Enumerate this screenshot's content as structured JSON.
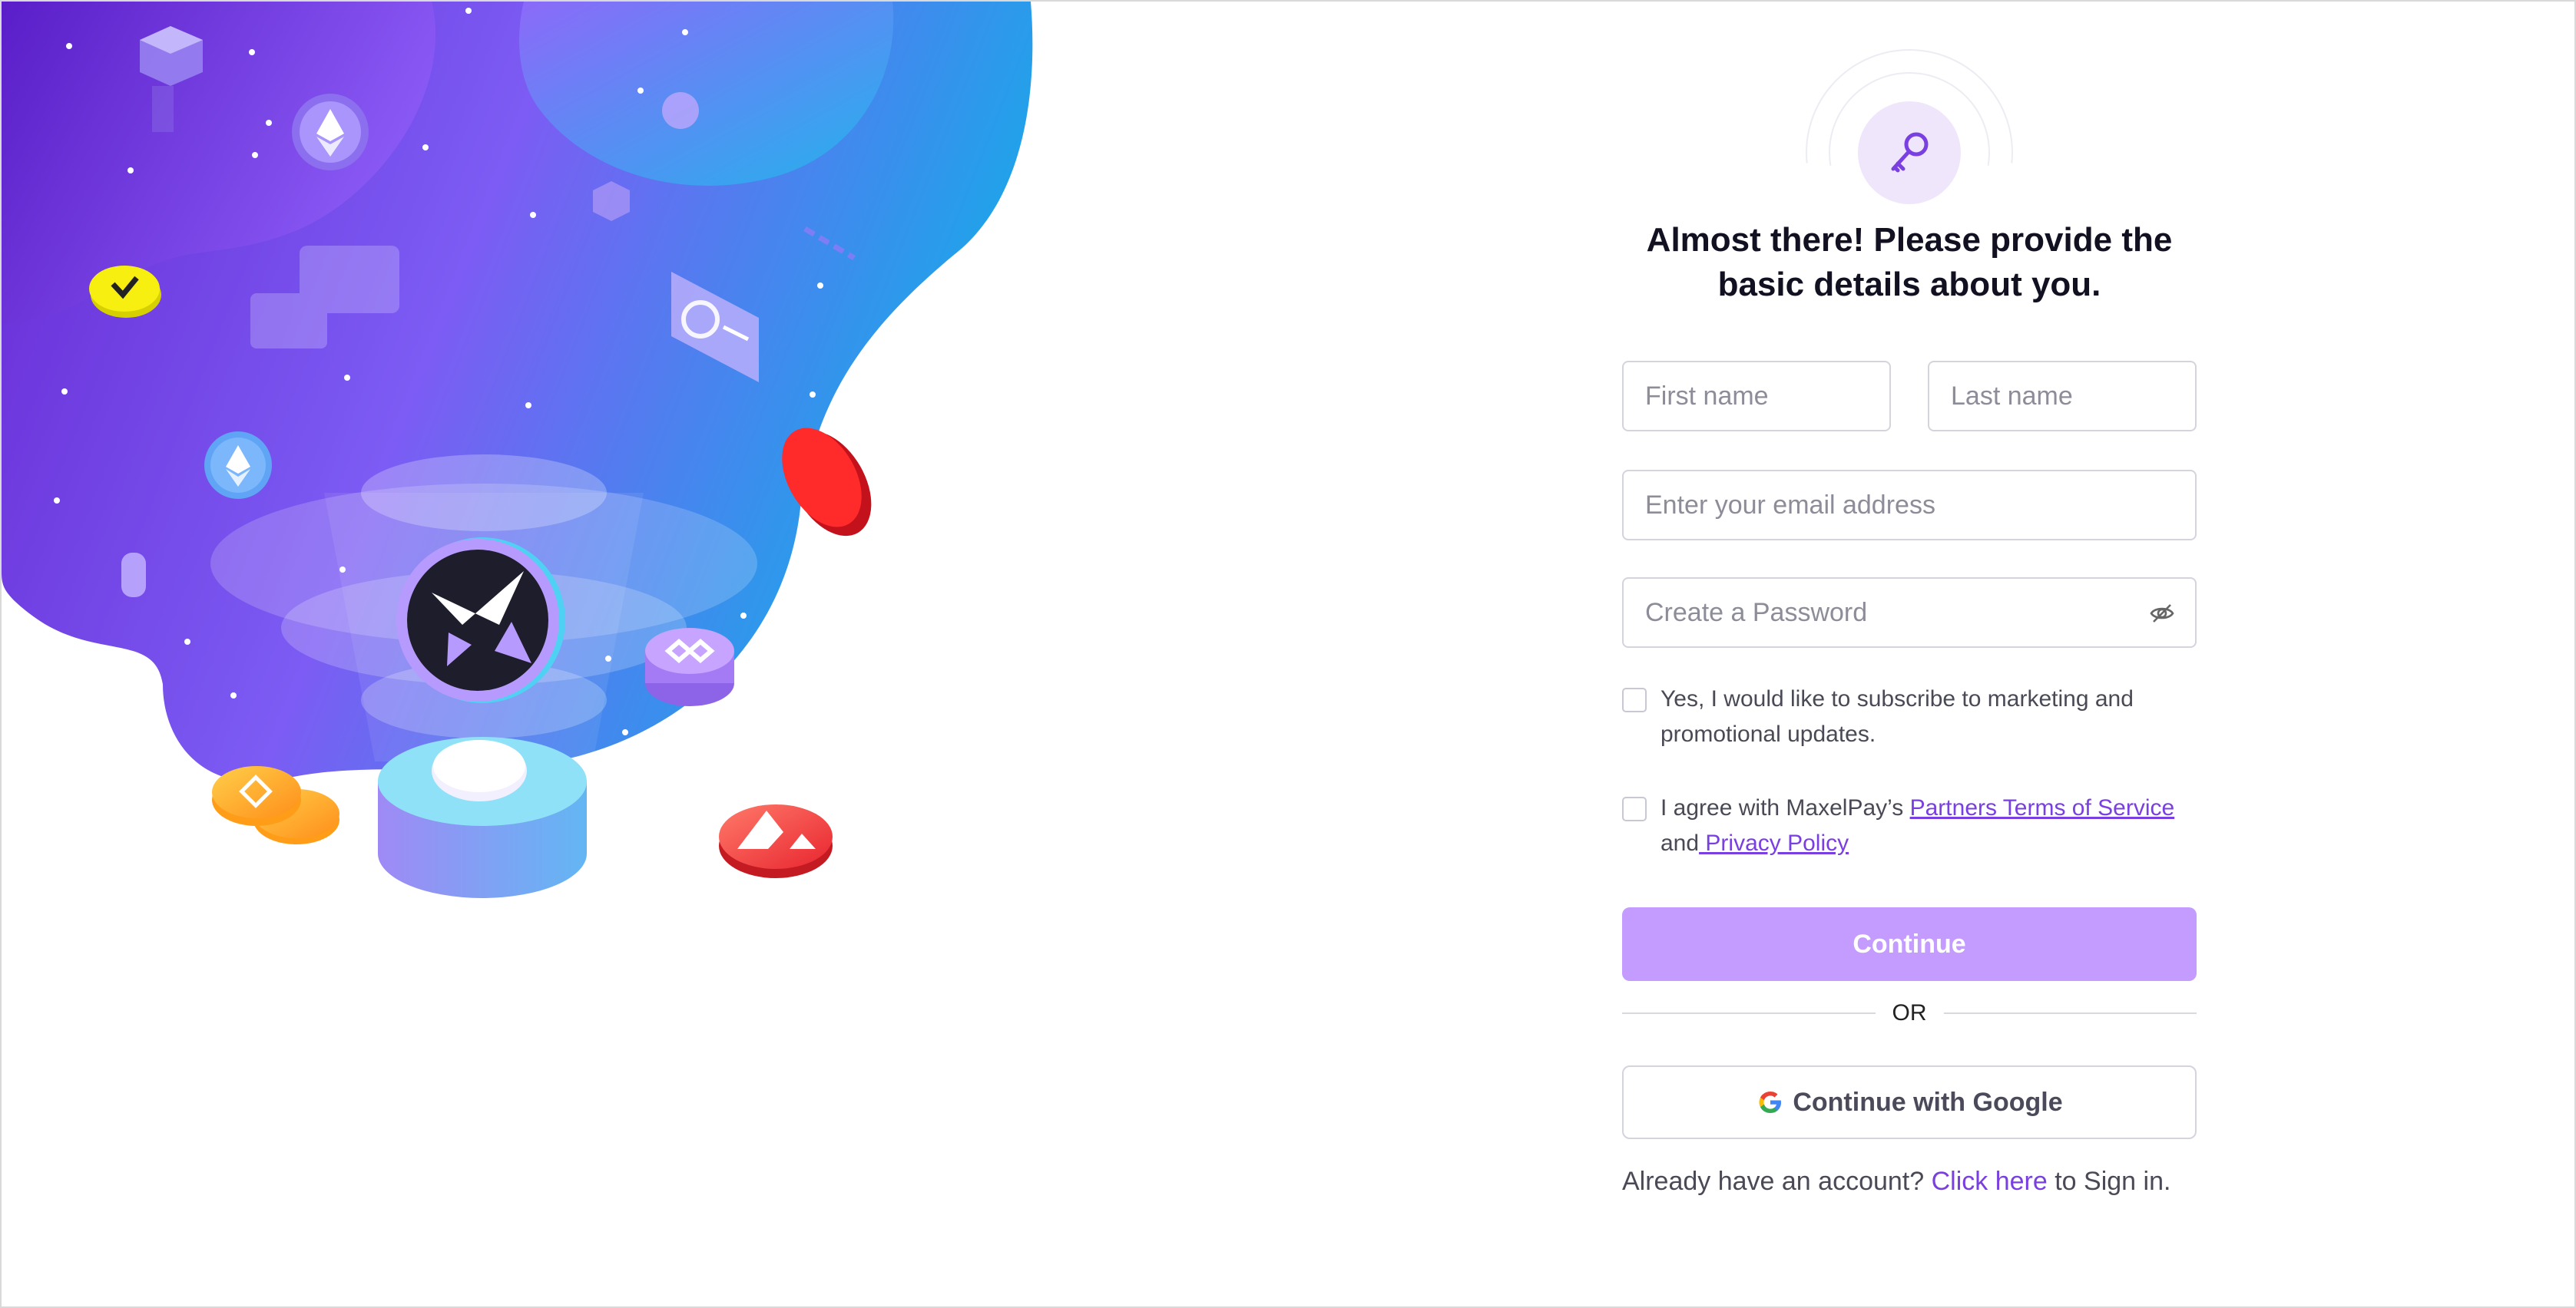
{
  "heading": {
    "line1": "Almost there! Please provide the",
    "line2": "basic details about you."
  },
  "fields": {
    "first_name_placeholder": "First name",
    "last_name_placeholder": "Last name",
    "email_placeholder": "Enter your email address",
    "password_placeholder": "Create a Password"
  },
  "marketing": {
    "text": "Yes, I would like to subscribe to marketing and promotional updates."
  },
  "terms": {
    "prefix": "I agree with MaxelPay’s ",
    "terms_link": "Partners Terms of Service",
    "and": " and",
    "privacy_link": " Privacy Policy"
  },
  "buttons": {
    "continue": "Continue",
    "or": "OR",
    "google": "Continue with Google"
  },
  "signin": {
    "prefix": "Already have an account? ",
    "link": "Click here",
    "suffix": " to Sign in."
  },
  "colors": {
    "accent": "#7a3fe0",
    "button_disabled": "#c49cff",
    "badge_bg": "#efe6fb"
  },
  "icons": {
    "badge": "key-icon",
    "password_toggle": "eye-off-icon",
    "google": "google-icon"
  }
}
